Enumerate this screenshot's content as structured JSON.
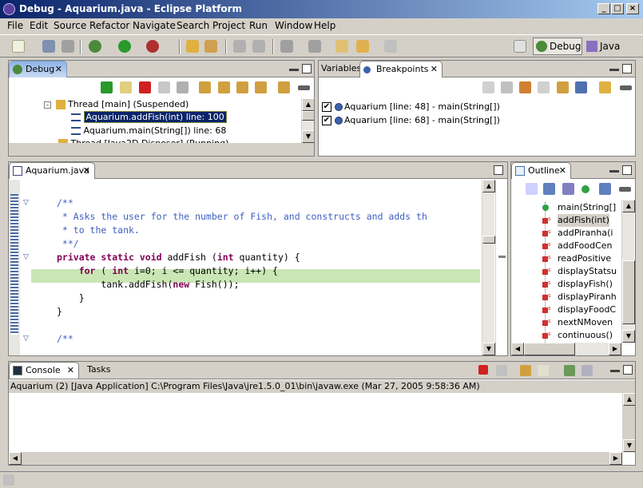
{
  "window": {
    "title": "Debug - Aquarium.java - Eclipse Platform",
    "minimize": "_",
    "maximize": "□",
    "close": "×"
  },
  "menu": [
    "File",
    "Edit",
    "Source",
    "Refactor",
    "Navigate",
    "Search",
    "Project",
    "Run",
    "Window",
    "Help"
  ],
  "perspectives": {
    "debug": "Debug",
    "java": "Java"
  },
  "debug_view": {
    "tab": "Debug",
    "tree": [
      {
        "label": "Thread [main] (Suspended)"
      },
      {
        "label": "Aquarium.addFish(int) line: 100",
        "selected": true
      },
      {
        "label": "Aquarium.main(String[]) line: 68"
      },
      {
        "label": "Thread [Java2D Disposer] (Running)"
      }
    ]
  },
  "variables_view": {
    "tabs": [
      "Variables",
      "Breakpoints"
    ],
    "breakpoints": [
      {
        "label": "Aquarium [line: 48] - main(String[])",
        "checked": "✔"
      },
      {
        "label": "Aquarium [line: 68] - main(String[])",
        "checked": "✔"
      }
    ]
  },
  "editor": {
    "tab": "Aquarium.java",
    "lines": [
      {
        "text": "/**",
        "type": "comment"
      },
      {
        "text": " * Asks the user for the number of Fish, and constructs and adds th",
        "type": "comment"
      },
      {
        "text": " * to the tank.",
        "type": "comment"
      },
      {
        "text": " **/",
        "type": "comment"
      },
      {
        "text": "private static void addFish (int quantity) {",
        "type": "code"
      },
      {
        "text": "    for ( int i=0; i <= quantity; i++) {",
        "type": "code",
        "highlight": true
      },
      {
        "text": "        tank.addFish(new Fish());",
        "type": "code"
      },
      {
        "text": "    }",
        "type": "code"
      },
      {
        "text": "}",
        "type": "code"
      },
      {
        "text": "",
        "type": "code"
      },
      {
        "text": "/**",
        "type": "comment"
      }
    ]
  },
  "outline": {
    "tab": "Outline",
    "items": [
      "main(String[]",
      "addFish(int)",
      "addPiranha(i",
      "addFoodCen",
      "readPositive",
      "displayStatsu",
      "displayFish()",
      "displayPiranh",
      "displayFoodC",
      "nextNMoven",
      "continuous()"
    ]
  },
  "console": {
    "tabs": [
      "Console",
      "Tasks"
    ],
    "status": "Aquarium (2) [Java Application] C:\\Program Files\\Java\\jre1.5.0_01\\bin\\javaw.exe (Mar 27, 2005 9:58:36 AM)"
  },
  "colors": {
    "keyword": "#7f0055",
    "comment": "#3f5fbf",
    "highlight": "#c9e6b4",
    "titlebar": "#0a246a"
  }
}
